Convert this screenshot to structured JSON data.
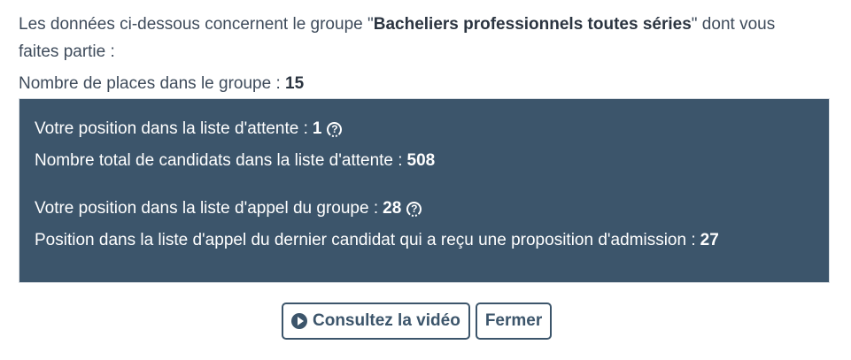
{
  "intro": {
    "prefix": "Les données ci-dessous concernent le groupe \"",
    "group_name": "Bacheliers professionnels toutes séries",
    "suffix_line1": "\" dont vous",
    "line2": "faites partie :"
  },
  "places": {
    "label": "Nombre de places dans le groupe :",
    "value": "15"
  },
  "info": {
    "waitlist_position_label": "Votre position dans la liste d'attente :",
    "waitlist_position_value": "1",
    "waitlist_total_label": "Nombre total de candidats dans la liste d'attente :",
    "waitlist_total_value": "508",
    "call_position_label": "Votre position dans la liste d'appel du groupe :",
    "call_position_value": "28",
    "last_admitted_label": "Position dans la liste d'appel du dernier candidat qui a reçu une proposition d'admission :",
    "last_admitted_value": "27",
    "help_glyph": "?"
  },
  "buttons": {
    "video_label": "Consultez la vidéo",
    "close_label": "Fermer"
  },
  "colors": {
    "panel_bg": "#3c556b",
    "text": "#3e4b5b"
  }
}
